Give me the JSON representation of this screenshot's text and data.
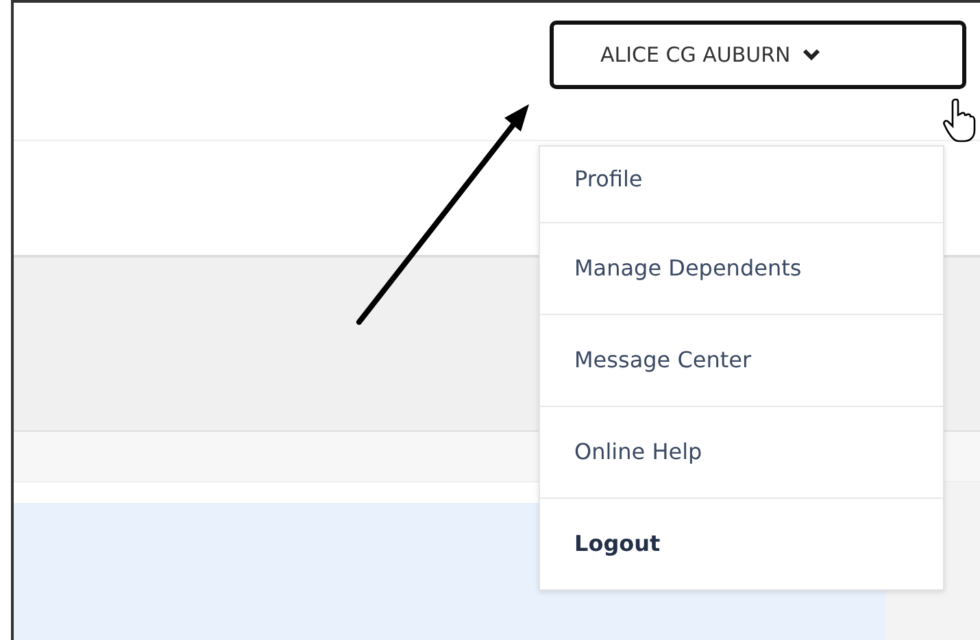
{
  "user_menu": {
    "label": "ALICE CG AUBURN",
    "expanded": true,
    "items": [
      {
        "label": "Profile",
        "kind": "link"
      },
      {
        "label": "Manage Dependents",
        "kind": "link"
      },
      {
        "label": "Message Center",
        "kind": "link"
      },
      {
        "label": "Online Help",
        "kind": "link"
      },
      {
        "label": "Logout",
        "kind": "action"
      }
    ]
  }
}
